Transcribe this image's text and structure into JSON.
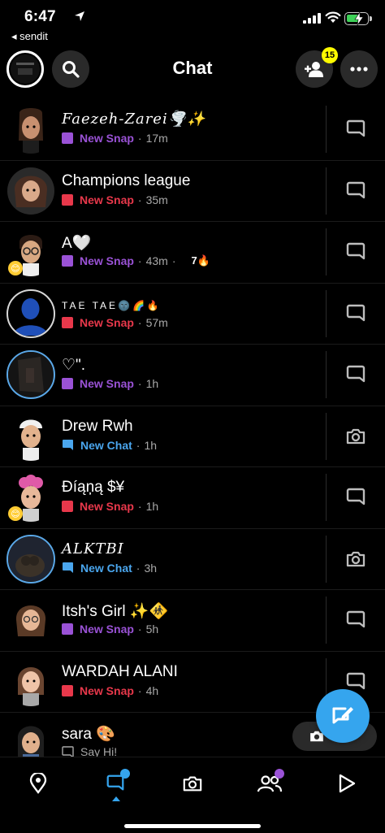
{
  "status_bar": {
    "time": "6:47",
    "back_app": "◂ sendit"
  },
  "header": {
    "title": "Chat",
    "friend_request_count": "15",
    "icons": [
      "profile-avatar",
      "search-icon",
      "add-friend-icon",
      "more-icon"
    ]
  },
  "chats": [
    {
      "name": "Faezeh-Zarei🌪️✨",
      "status": "New Snap",
      "status_type": "purple",
      "time": "17m",
      "streak": "",
      "action": "chat-icon"
    },
    {
      "name": "Champions league",
      "status": "New Snap",
      "status_type": "red",
      "time": "35m",
      "streak": "",
      "action": "chat-icon"
    },
    {
      "name": "A🤍",
      "status": "New Snap",
      "status_type": "purple",
      "time": "43m",
      "streak": "7🔥",
      "action": "chat-icon"
    },
    {
      "name": "TAE TAE🌚🌈🔥",
      "status": "New Snap",
      "status_type": "red",
      "time": "57m",
      "streak": "",
      "action": "chat-icon"
    },
    {
      "name": "♡\".",
      "status": "New Snap",
      "status_type": "purple",
      "time": "1h",
      "streak": "",
      "action": "chat-icon"
    },
    {
      "name": "Drew Rwh",
      "status": "New Chat",
      "status_type": "blue",
      "time": "1h",
      "streak": "",
      "action": "camera-icon"
    },
    {
      "name": "Đíąņą $¥",
      "status": "New Snap",
      "status_type": "red",
      "time": "1h",
      "streak": "",
      "action": "chat-icon"
    },
    {
      "name": "ALKTBI",
      "status": "New Chat",
      "status_type": "blue",
      "time": "3h",
      "streak": "",
      "action": "camera-icon"
    },
    {
      "name": "Itsh's Girl ✨🚸",
      "status": "New Snap",
      "status_type": "purple",
      "time": "5h",
      "streak": "",
      "action": "chat-icon"
    },
    {
      "name": "WARDAH ALANI",
      "status": "New Snap",
      "status_type": "red",
      "time": "4h",
      "streak": "",
      "action": "chat-icon"
    },
    {
      "name": "sara 🎨",
      "status": "Say Hi!",
      "status_type": "hi",
      "time": "",
      "streak": "",
      "action": "camera-pill"
    }
  ],
  "bottom_nav": {
    "items": [
      "map-icon",
      "chat-icon",
      "camera-icon",
      "friends-icon",
      "spotlight-icon"
    ],
    "active": "chat-icon"
  },
  "colors": {
    "background": "#000000",
    "new_snap_purple": "#9a52d6",
    "new_snap_red": "#e8384b",
    "new_chat_blue": "#4aa6ee",
    "badge_yellow": "#fffc00",
    "fab_blue": "#35a5ee"
  }
}
